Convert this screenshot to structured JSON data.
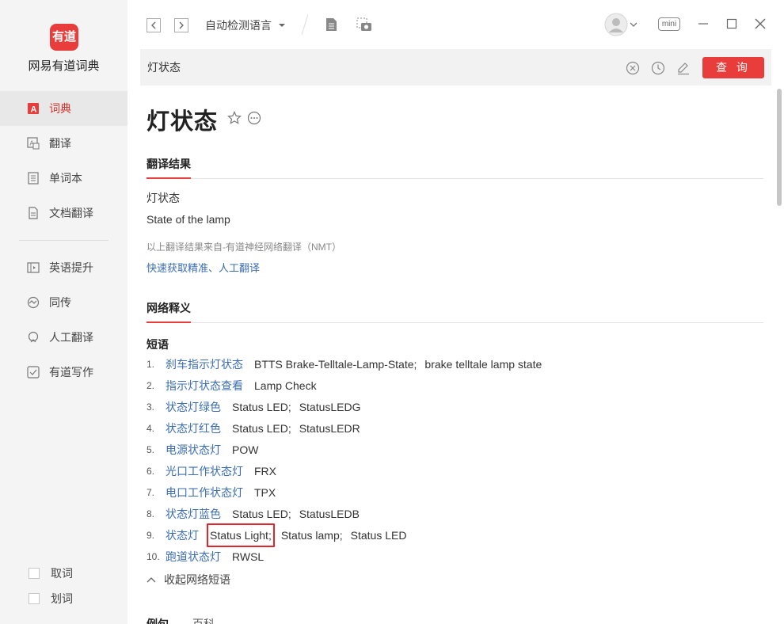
{
  "app": {
    "logo_text": "有道",
    "name": "网易有道词典"
  },
  "sidebar": {
    "items": [
      {
        "label": "词典",
        "icon": "dictionary-icon",
        "active": true
      },
      {
        "label": "翻译",
        "icon": "translate-icon"
      },
      {
        "label": "单词本",
        "icon": "wordbook-icon"
      },
      {
        "label": "文档翻译",
        "icon": "document-translate-icon"
      },
      {
        "label": "英语提升",
        "icon": "english-improve-icon"
      },
      {
        "label": "同传",
        "icon": "simultaneous-interpretation-icon"
      },
      {
        "label": "人工翻译",
        "icon": "human-translation-icon"
      },
      {
        "label": "有道写作",
        "icon": "writing-icon"
      }
    ],
    "checks": [
      {
        "label": "取词"
      },
      {
        "label": "划词"
      }
    ]
  },
  "topbar": {
    "language": "自动检测语言",
    "mini_label": "mini"
  },
  "search": {
    "value": "灯状态",
    "button_label": "查 询"
  },
  "entry": {
    "headword": "灯状态",
    "translation_title": "翻译结果",
    "translation_cn": "灯状态",
    "translation_en": "State of the lamp",
    "nmt_note": "以上翻译结果来自-有道神经网络翻译（NMT）",
    "quick_link": "快速获取精准、人工翻译",
    "web_title": "网络释义",
    "phrase_heading": "短语",
    "phrases": [
      {
        "num": "1.",
        "key": "刹车指示灯状态",
        "vals": [
          "BTTS Brake-Telltale-Lamp-State;",
          "brake telltale lamp state"
        ]
      },
      {
        "num": "2.",
        "key": "指示灯状态查看",
        "vals": [
          "Lamp Check"
        ]
      },
      {
        "num": "3.",
        "key": "状态灯绿色",
        "vals": [
          "Status LED;",
          "StatusLEDG"
        ]
      },
      {
        "num": "4.",
        "key": "状态灯红色",
        "vals": [
          "Status LED;",
          "StatusLEDR"
        ]
      },
      {
        "num": "5.",
        "key": "电源状态灯",
        "vals": [
          "POW"
        ]
      },
      {
        "num": "6.",
        "key": "光口工作状态灯",
        "vals": [
          "FRX"
        ]
      },
      {
        "num": "7.",
        "key": "电口工作状态灯",
        "vals": [
          "TPX"
        ]
      },
      {
        "num": "8.",
        "key": "状态灯蓝色",
        "vals": [
          "Status LED;",
          "StatusLEDB"
        ]
      },
      {
        "num": "9.",
        "key": "状态灯",
        "vals": [
          "Status Light;",
          "Status lamp;",
          "Status LED"
        ]
      },
      {
        "num": "10.",
        "key": "跑道状态灯",
        "vals": [
          "RWSL"
        ]
      }
    ],
    "collapse_label": "收起网络短语",
    "bottom_tabs": [
      "例句",
      "百科"
    ]
  },
  "colors": {
    "accent": "#e93d3b",
    "link": "#3a6db5",
    "highlight_box": "#e3242b"
  }
}
